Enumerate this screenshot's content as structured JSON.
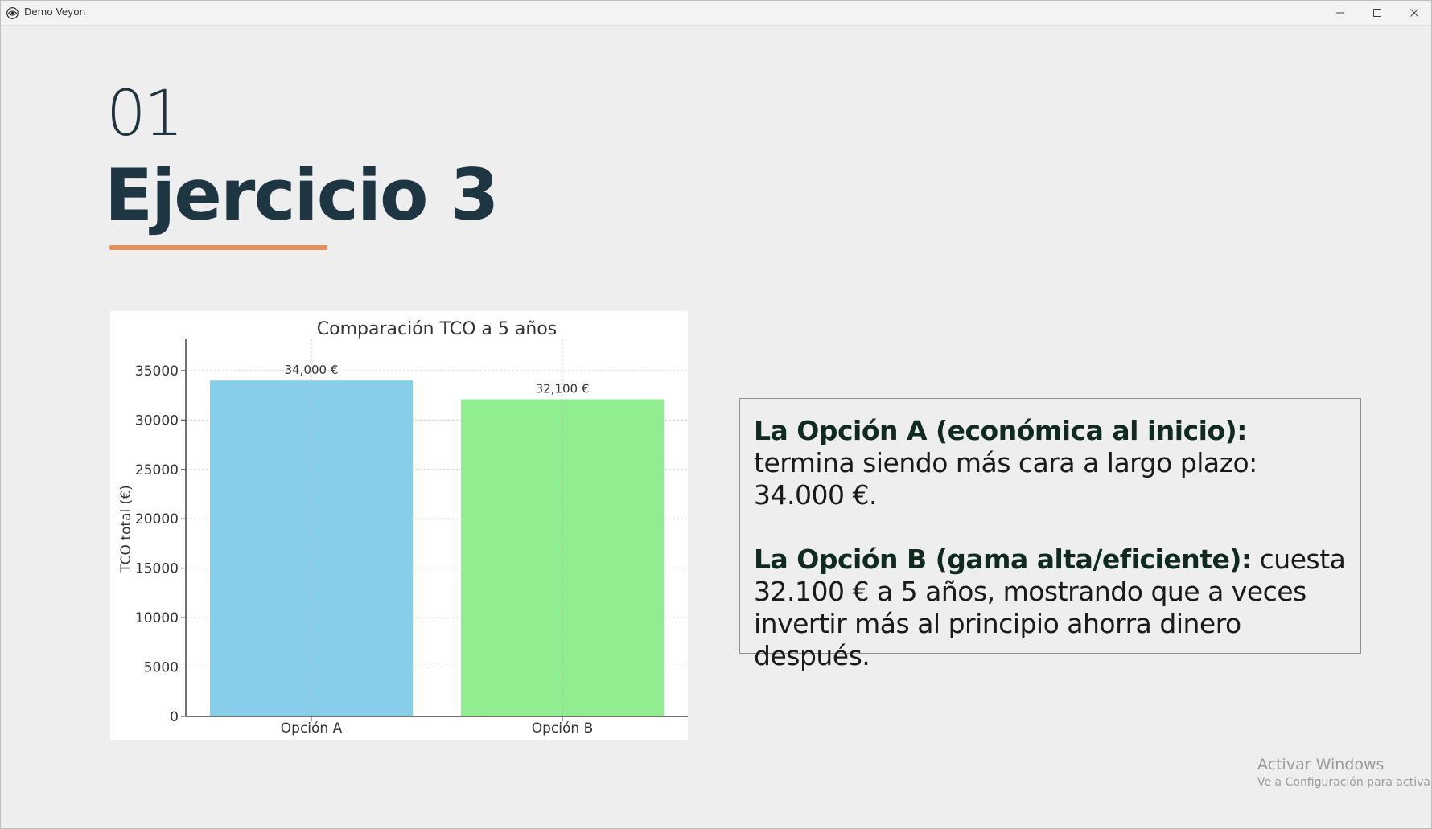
{
  "window": {
    "title": "Demo Veyon",
    "controls": {
      "minimize_icon": "minimize-icon",
      "maximize_icon": "maximize-icon",
      "close_icon": "close-icon"
    }
  },
  "slide": {
    "number": "01",
    "title": "Ejercicio 3",
    "accent_color": "#e58f57",
    "title_color": "#1d3641"
  },
  "info": {
    "p1_bold": "La Opción A (económica al inicio):",
    "p1_text": " termina siendo más cara a largo plazo: 34.000 €.",
    "p2_bold": "La Opción B (gama alta/eficiente):",
    "p2_text": " cuesta 32.100 € a 5 años, mostrando que a veces invertir más al principio ahorra dinero después."
  },
  "watermark": {
    "title": "Activar Windows",
    "subtitle": "Ve a Configuración para activar Windows."
  },
  "chart_data": {
    "type": "bar",
    "title": "Comparación TCO a 5 años",
    "xlabel": "",
    "ylabel": "TCO total (€)",
    "categories": [
      "Opción A",
      "Opción B"
    ],
    "values": [
      34000,
      32100
    ],
    "data_labels": [
      "34,000 €",
      "32,100 €"
    ],
    "colors": [
      "#87ceeb",
      "#90ee90"
    ],
    "ylim": [
      0,
      38000
    ],
    "yticks": [
      0,
      5000,
      10000,
      15000,
      20000,
      25000,
      30000,
      35000
    ],
    "grid": true,
    "legend": "none"
  }
}
